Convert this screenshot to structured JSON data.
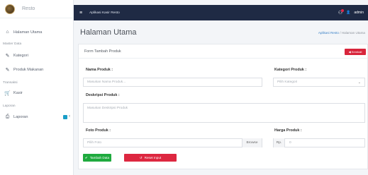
{
  "brand": {
    "name": "Resto"
  },
  "sidebar": {
    "home": {
      "label": "Halaman Utama",
      "icon": "home-icon"
    },
    "section_master": "Master Data",
    "kategori": {
      "label": "Kategori",
      "icon": "edit-icon"
    },
    "produk": {
      "label": "Produk Makanan",
      "icon": "edit-icon"
    },
    "section_transaksi": "Transaksi",
    "kasir": {
      "label": "Kasir",
      "icon": "cart-icon"
    },
    "section_laporan": "Laporan",
    "laporan": {
      "label": "Laporan",
      "icon": "print-icon"
    }
  },
  "topbar": {
    "title": "Aplikasi Kasir Resto",
    "user": "admin"
  },
  "page": {
    "title": "Halaman Utama",
    "breadcrumb_link": "Aplikasi Resto",
    "breadcrumb_sep": "/",
    "breadcrumb_current": "Halaman Utama"
  },
  "form": {
    "card_title": "Form Tambah Produk",
    "back_button": "Kembali",
    "nama_label": "Nama Produk :",
    "nama_placeholder": "Masukan Nama Produk...",
    "kategori_label": "Kategori Produk :",
    "kategori_value": "Pilih Kategori",
    "deskripsi_label": "Deskripsi Produk :",
    "deskripsi_placeholder": "Masukan Deskripsi Produk",
    "foto_label": "Foto Produk :",
    "foto_value": "Pilih Foto",
    "browse_label": "Browse",
    "harga_label": "Harga Produk :",
    "harga_prefix": "Rp.",
    "harga_value": "0",
    "save_button": "Tambah Data",
    "reset_button": "Reset Input"
  },
  "colors": {
    "topbar": "#1f2a44",
    "save": "#1faa3e",
    "danger": "#dd2740",
    "link": "#3a80c6"
  }
}
